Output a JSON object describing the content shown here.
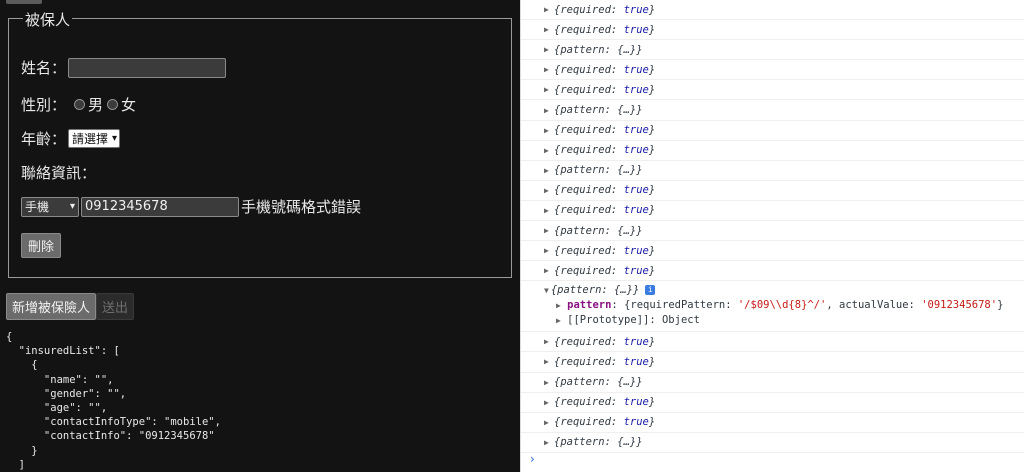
{
  "form": {
    "legend": "被保人",
    "name_label": "姓名：",
    "name_value": "",
    "gender_label": "性別：",
    "gender_male": "男",
    "gender_female": "女",
    "age_label": "年齡：",
    "age_select": "請選擇",
    "contact_label": "聯絡資訊：",
    "contact_type": "手機",
    "contact_value": "0912345678",
    "contact_error": "手機號碼格式錯誤",
    "delete_button": "刪除"
  },
  "actions": {
    "add_insured": "新增被保險人",
    "submit": "送出"
  },
  "json_preview": "{\n  \"insuredList\": [\n    {\n      \"name\": \"\",\n      \"gender\": \"\",\n      \"age\": \"\",\n      \"contactInfoType\": \"mobile\",\n      \"contactInfo\": \"0912345678\"\n    }\n  ]",
  "console": {
    "entries_before": [
      {
        "key": "required",
        "value": "true"
      },
      {
        "key": "required",
        "value": "true"
      },
      {
        "key": "pattern",
        "value": "{…}"
      },
      {
        "key": "required",
        "value": "true"
      },
      {
        "key": "required",
        "value": "true"
      },
      {
        "key": "pattern",
        "value": "{…}"
      },
      {
        "key": "required",
        "value": "true"
      },
      {
        "key": "required",
        "value": "true"
      },
      {
        "key": "pattern",
        "value": "{…}"
      },
      {
        "key": "required",
        "value": "true"
      },
      {
        "key": "required",
        "value": "true"
      },
      {
        "key": "pattern",
        "value": "{…}"
      },
      {
        "key": "required",
        "value": "true"
      },
      {
        "key": "required",
        "value": "true"
      }
    ],
    "expanded": {
      "summary": "{pattern: {…}}",
      "info_icon": "i",
      "detail_key": "pattern",
      "detail_prefix": ": {requiredPattern: ",
      "required_pattern": "'/$09\\\\d{8}^/'",
      "detail_mid": ", actualValue: ",
      "actual_value": "'0912345678'",
      "detail_suffix": "}",
      "prototype": "[[Prototype]]: Object"
    },
    "entries_after": [
      {
        "key": "required",
        "value": "true"
      },
      {
        "key": "required",
        "value": "true"
      },
      {
        "key": "pattern",
        "value": "{…}"
      },
      {
        "key": "required",
        "value": "true"
      },
      {
        "key": "required",
        "value": "true"
      },
      {
        "key": "pattern",
        "value": "{…}"
      }
    ],
    "prompt": "›"
  }
}
